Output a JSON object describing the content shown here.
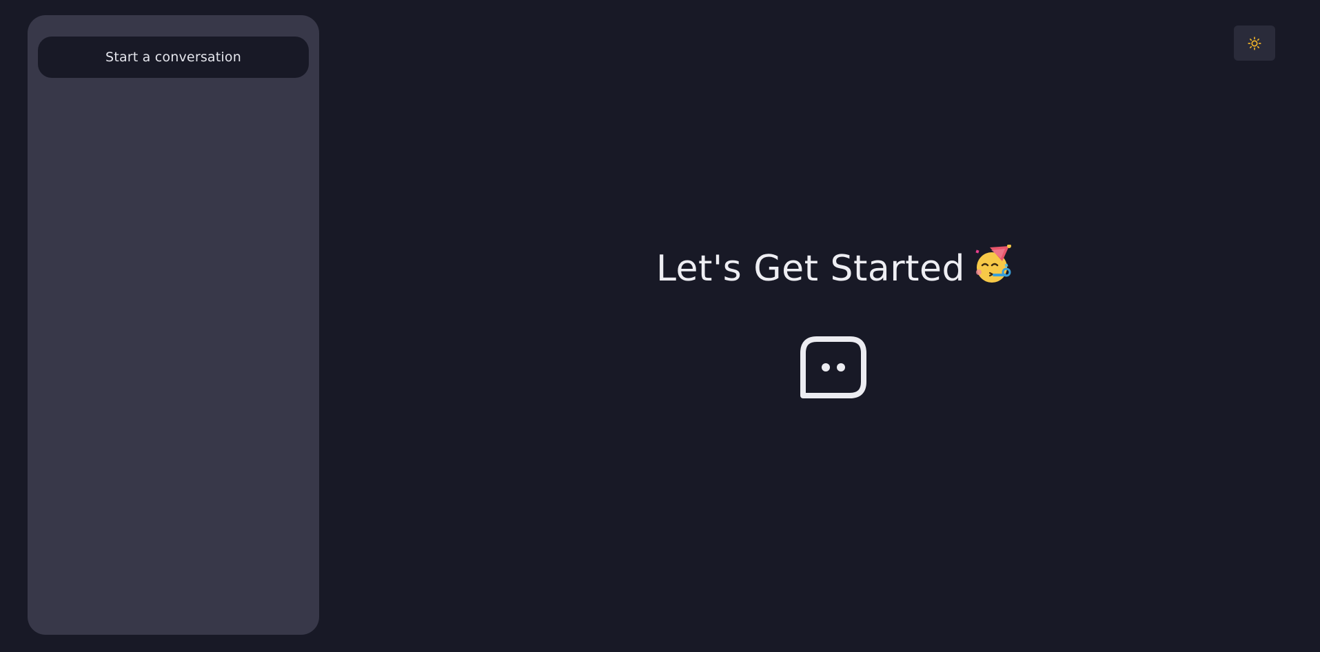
{
  "sidebar": {
    "new_chat_label": "Start a conversation"
  },
  "header": {
    "theme_toggle_icon": "sun-icon"
  },
  "main": {
    "welcome_title": "Let's Get Started",
    "welcome_emoji": "party-face-emoji",
    "hero_icon": "chat-bot-icon"
  },
  "colors": {
    "background": "#181926",
    "sidebar": "#383849",
    "button": "#181926",
    "text": "#eeeef3",
    "accent_sun": "#f0b429"
  }
}
